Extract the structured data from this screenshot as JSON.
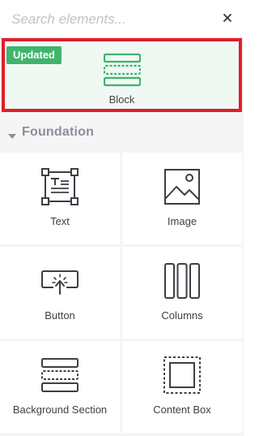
{
  "search": {
    "placeholder": "Search elements...",
    "value": "",
    "clear_icon": "close-icon"
  },
  "featured": {
    "badge": "Updated",
    "label": "Block",
    "icon": "block-icon",
    "highlight_color": "#e01e2b",
    "accent_color": "#3fb46c"
  },
  "section": {
    "title": "Foundation",
    "icon": "caret-down-icon",
    "expanded": true
  },
  "elements": [
    {
      "label": "Text",
      "icon": "text-icon"
    },
    {
      "label": "Image",
      "icon": "image-icon"
    },
    {
      "label": "Button",
      "icon": "button-icon"
    },
    {
      "label": "Columns",
      "icon": "columns-icon"
    },
    {
      "label": "Background Section",
      "icon": "background-section-icon"
    },
    {
      "label": "Content Box",
      "icon": "content-box-icon"
    }
  ]
}
